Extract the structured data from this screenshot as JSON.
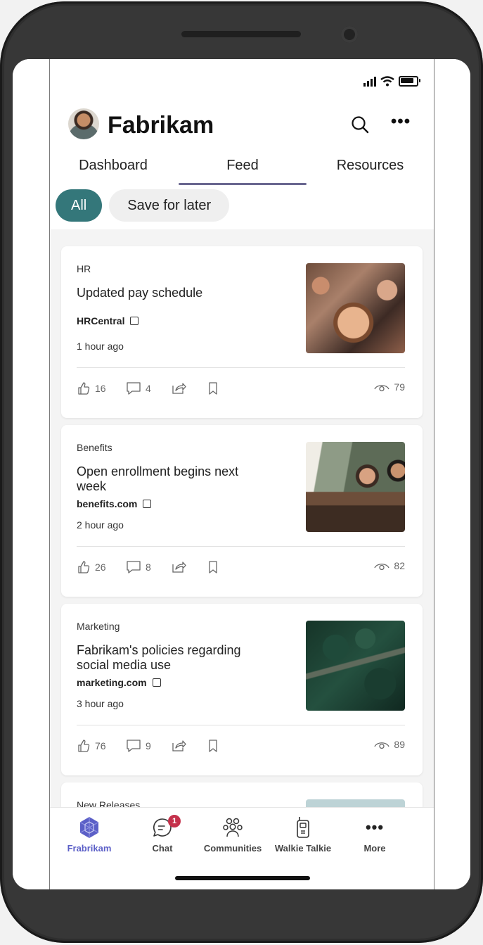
{
  "app": {
    "title": "Fabrikam"
  },
  "tabs": [
    {
      "label": "Dashboard"
    },
    {
      "label": "Feed",
      "active": true
    },
    {
      "label": "Resources"
    }
  ],
  "filters": [
    {
      "label": "All",
      "active": true
    },
    {
      "label": "Save for later"
    }
  ],
  "feed": [
    {
      "category": "HR",
      "title": "Updated pay schedule",
      "source": "HRCentral",
      "time": "1 hour ago",
      "likes": "16",
      "comments": "4",
      "views": "79"
    },
    {
      "category": "Benefits",
      "title": "Open enrollment begins next week",
      "source": "benefits.com",
      "time": "2 hour ago",
      "likes": "26",
      "comments": "8",
      "views": "82"
    },
    {
      "category": "Marketing",
      "title": "Fabrikam's policies regarding social media use",
      "source": "marketing.com",
      "time": "3 hour ago",
      "likes": "76",
      "comments": "9",
      "views": "89"
    },
    {
      "category": "New Releases"
    }
  ],
  "bottom_nav": [
    {
      "label": "Frabrikam",
      "icon": "fabrikam-app-icon",
      "active": true
    },
    {
      "label": "Chat",
      "icon": "chat-icon",
      "badge": "1"
    },
    {
      "label": "Communities",
      "icon": "communities-icon"
    },
    {
      "label": "Walkie Talkie",
      "icon": "walkie-talkie-icon"
    },
    {
      "label": "More",
      "icon": "more-icon"
    }
  ],
  "colors": {
    "accent": "#34777a",
    "nav_active": "#5b5fc7",
    "tab_underline": "#6a6790",
    "badge": "#c4314b"
  }
}
